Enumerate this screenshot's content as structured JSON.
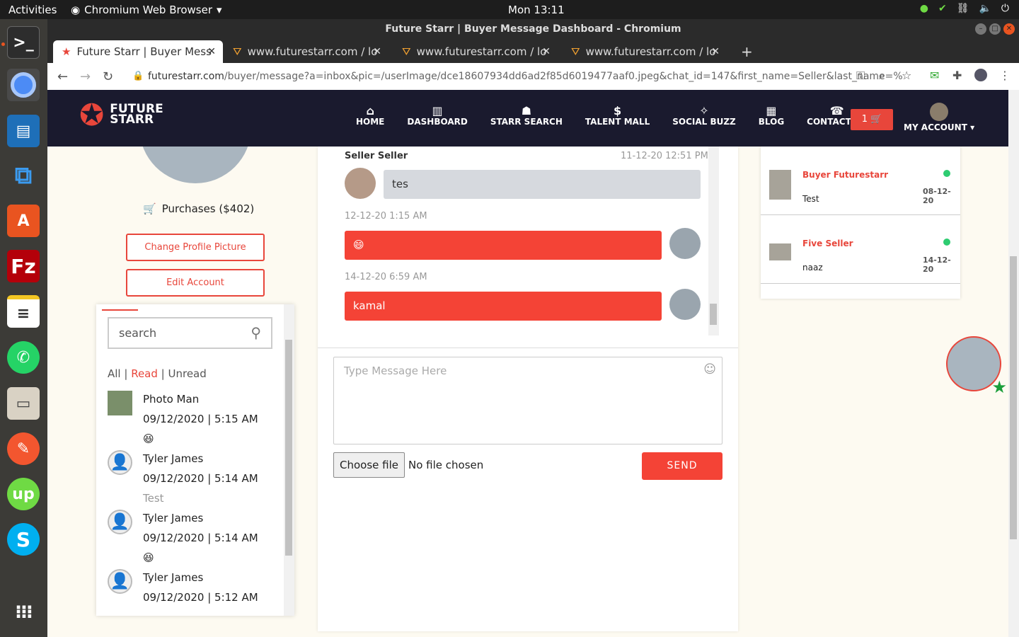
{
  "os": {
    "activities": "Activities",
    "app_name": "Chromium Web Browser",
    "clock": "Mon 13:11"
  },
  "window": {
    "title": "Future Starr | Buyer Message Dashboard - Chromium"
  },
  "tabs": [
    {
      "label": "Future Starr | Buyer Mess"
    },
    {
      "label": "www.futurestarr.com / lo"
    },
    {
      "label": "www.futurestarr.com / lo"
    },
    {
      "label": "www.futurestarr.com / lo"
    }
  ],
  "address": {
    "host": "futurestarr.com",
    "path": "/buyer/message?a=inbox&pic=/userImage/dce18607934dd6ad2f85d6019477aaf0.jpeg&chat_id=147&first_name=Seller&last_name=%20S..."
  },
  "site": {
    "logo_line1": "FUTURE",
    "logo_line2": "STARR",
    "menu": [
      "HOME",
      "DASHBOARD",
      "STARR SEARCH",
      "TALENT MALL",
      "SOCIAL BUZZ",
      "BLOG",
      "CONTACT US"
    ],
    "cart_count": "1",
    "my_account": "MY ACCOUNT"
  },
  "profile": {
    "purchases": "Purchases ($402)",
    "change_pic": "Change Profile Picture",
    "edit_account": "Edit Account"
  },
  "inbox": {
    "search_placeholder": "search",
    "filter_all": "All",
    "filter_read": "Read",
    "filter_unread": "Unread",
    "items": [
      {
        "name": "Photo Man",
        "date": "09/12/2020 | 5:15 AM",
        "msg": "😆"
      },
      {
        "name": "Tyler James",
        "date": "09/12/2020 | 5:14 AM",
        "msg": "Test"
      },
      {
        "name": "Tyler James",
        "date": "09/12/2020 | 5:14 AM",
        "msg": "😆"
      },
      {
        "name": "Tyler James",
        "date": "09/12/2020 | 5:12 AM",
        "msg": ""
      }
    ]
  },
  "chat": {
    "sender": "Seller Seller",
    "sender_time": "11-12-20 12:51 PM",
    "msg1": "tes",
    "ts2": "12-12-20 1:15 AM",
    "msg2": "😄",
    "ts3": "14-12-20 6:59 AM",
    "msg3": "kamal",
    "placeholder": "Type Message Here",
    "choose_file": "Choose file",
    "no_file": "No file chosen",
    "send": "SEND"
  },
  "contacts": [
    {
      "name": "Buyer Futurestarr",
      "date": "08-12-20",
      "msg": "Test"
    },
    {
      "name": "Five Seller",
      "date": "14-12-20",
      "msg": "naaz"
    }
  ]
}
